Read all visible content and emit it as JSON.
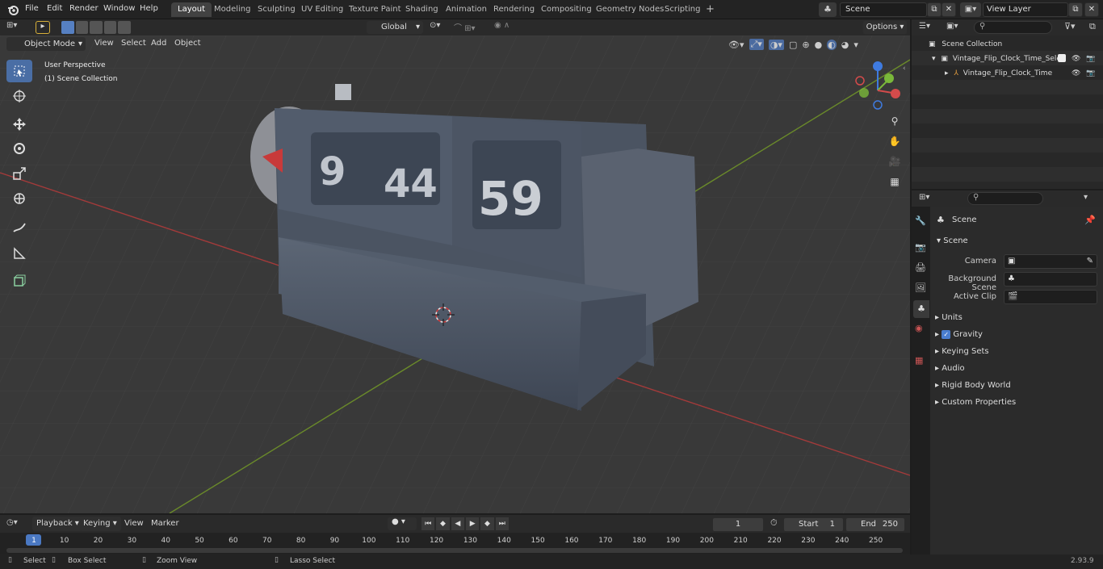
{
  "app": {
    "menus": [
      "File",
      "Edit",
      "Render",
      "Window",
      "Help"
    ]
  },
  "workspaces": {
    "tabs": [
      "Layout",
      "Modeling",
      "Sculpting",
      "UV Editing",
      "Texture Paint",
      "Shading",
      "Animation",
      "Rendering",
      "Compositing",
      "Geometry Nodes",
      "Scripting"
    ],
    "active": "Layout",
    "add": "+"
  },
  "scene_selector": {
    "value": "Scene"
  },
  "view_layer": {
    "value": "View Layer"
  },
  "viewport_header": {
    "mode": "Object Mode",
    "menus": [
      "View",
      "Select",
      "Add",
      "Object"
    ],
    "orientation": "Global",
    "options": "Options"
  },
  "viewport": {
    "perspective": "User Perspective",
    "collection": "(1) Scene Collection"
  },
  "outliner": {
    "root": "Scene Collection",
    "items": [
      {
        "name": "Vintage_Flip_Clock_Time_Sele"
      },
      {
        "name": "Vintage_Flip_Clock_Time"
      }
    ]
  },
  "properties": {
    "context": "Scene",
    "section": "Scene",
    "camera_label": "Camera",
    "bg_label": "Background Scene",
    "clip_label": "Active Clip",
    "panels": [
      "Units",
      "Gravity",
      "Keying Sets",
      "Audio",
      "Rigid Body World",
      "Custom Properties"
    ]
  },
  "clock_digits": {
    "hour": "9",
    "min": "44",
    "sec": "59"
  },
  "timeline": {
    "menus": [
      "Playback",
      "Keying",
      "View",
      "Marker"
    ],
    "current_frame": "1",
    "start_label": "Start",
    "start": "1",
    "end_label": "End",
    "end": "250",
    "ticks": [
      "1",
      "10",
      "20",
      "30",
      "40",
      "50",
      "60",
      "70",
      "80",
      "90",
      "100",
      "110",
      "120",
      "130",
      "140",
      "150",
      "160",
      "170",
      "180",
      "190",
      "200",
      "210",
      "220",
      "230",
      "240",
      "250"
    ]
  },
  "status": {
    "select": "Select",
    "box_select": "Box Select",
    "zoom": "Zoom View",
    "lasso": "Lasso Select",
    "version": "2.93.9"
  }
}
